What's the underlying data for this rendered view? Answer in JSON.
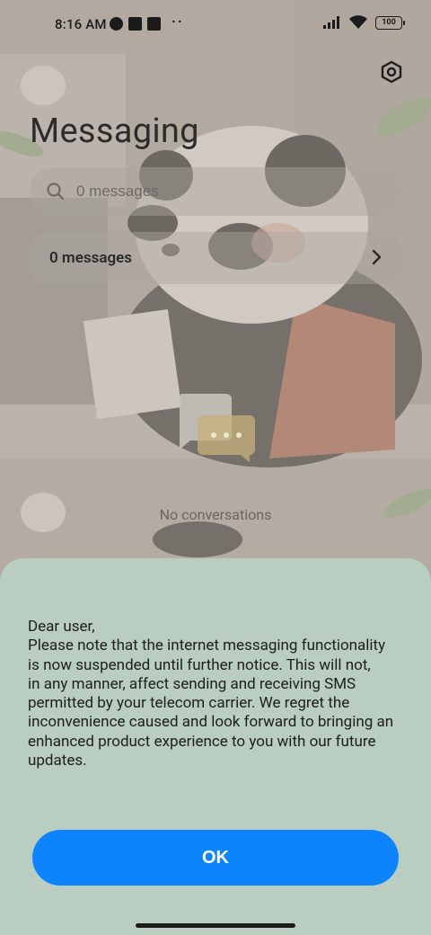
{
  "status_bar": {
    "time": "8:16 AM",
    "battery": "100"
  },
  "header": {
    "title": "Messaging",
    "settings_icon": "settings-hexagon-icon"
  },
  "search": {
    "placeholder": "0 messages",
    "value": ""
  },
  "messages_row": {
    "label": "0 messages"
  },
  "empty_state": {
    "text": "No conversations"
  },
  "dialog": {
    "greeting": "Dear user,",
    "lines": [
      "Please note that the internet messaging functionality",
      "is now suspended until further notice. This will not,",
      "in any manner, affect sending and receiving SMS",
      "permitted by your telecom carrier. We regret the",
      "inconvenience caused and look forward to bringing an",
      "enhanced product experience to you with our future",
      "updates."
    ],
    "ok_label": "OK"
  },
  "colors": {
    "sheet_background": "#b9cec0",
    "ok_button": "#0d84fe"
  }
}
